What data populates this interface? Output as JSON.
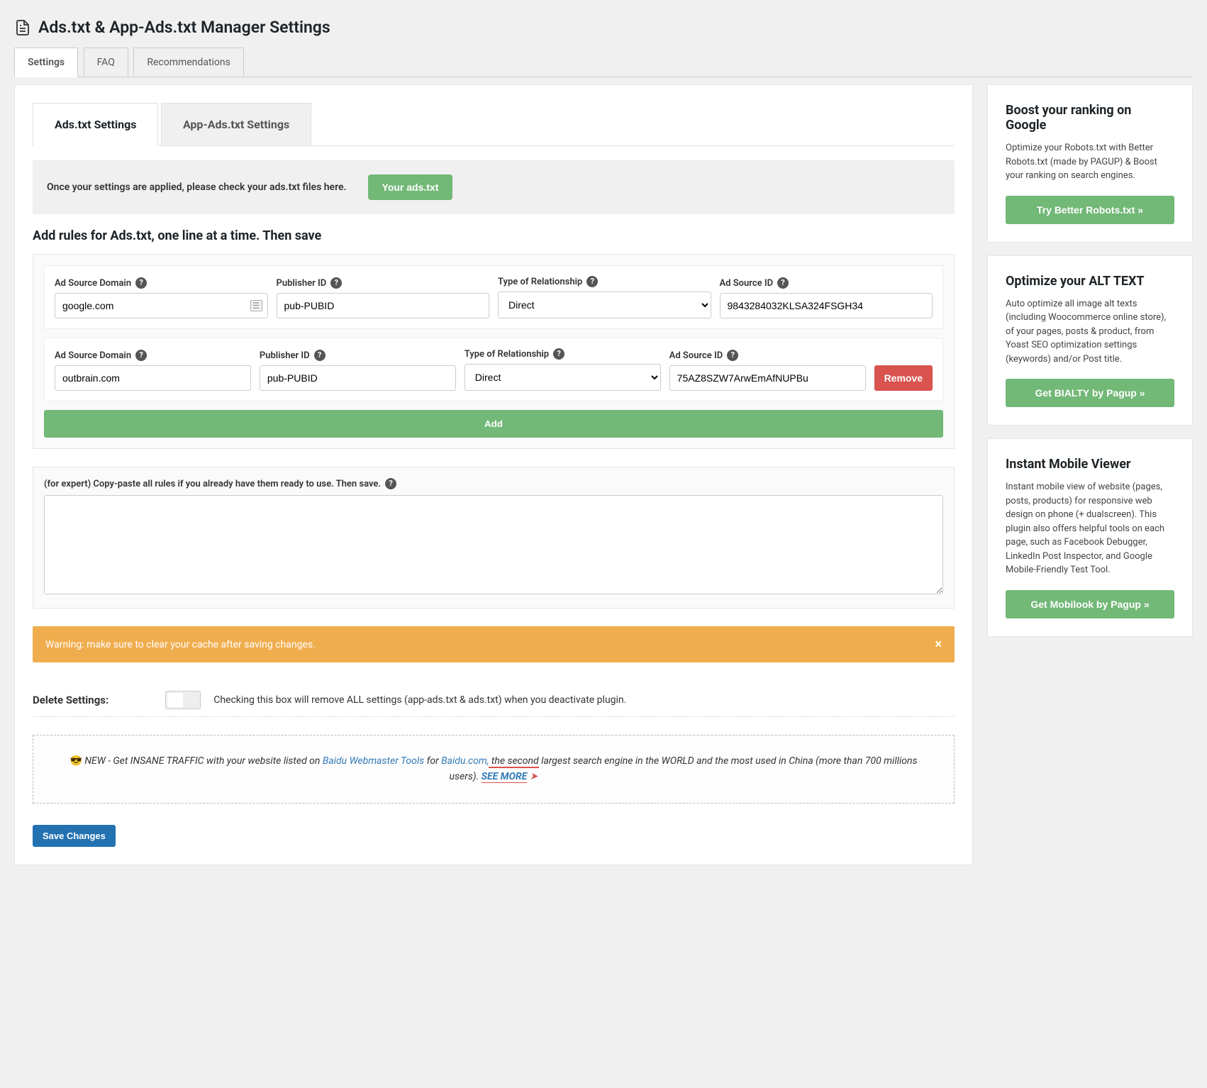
{
  "pageTitle": "Ads.txt & App-Ads.txt Manager Settings",
  "topTabs": [
    "Settings",
    "FAQ",
    "Recommendations"
  ],
  "innerTabs": [
    "Ads.txt Settings",
    "App-Ads.txt Settings"
  ],
  "notice": {
    "text": "Once your settings are applied, please check your ads.txt files here.",
    "button": "Your ads.txt"
  },
  "sectionHeading": "Add rules for Ads.txt, one line at a time. Then save",
  "fieldLabels": {
    "domain": "Ad Source Domain",
    "publisherId": "Publisher ID",
    "relationship": "Type of Relationship",
    "sourceId": "Ad Source ID"
  },
  "relationshipOptions": [
    "Direct"
  ],
  "rows": [
    {
      "domain": "google.com",
      "publisherId": "pub-PUBID",
      "relationship": "Direct",
      "sourceId": "9843284032KLSA324FSGH34",
      "hasRemove": false,
      "hasIcon": true
    },
    {
      "domain": "outbrain.com",
      "publisherId": "pub-PUBID",
      "relationship": "Direct",
      "sourceId": "75AZ8SZW7ArwEmAfNUPBu",
      "hasRemove": true,
      "hasIcon": false
    }
  ],
  "addButton": "Add",
  "removeButton": "Remove",
  "expert": {
    "label": "(for expert) Copy-paste all rules if you already have them ready to use. Then save.",
    "value": ""
  },
  "warning": "Warning: make sure to clear your cache after saving changes.",
  "deleteSection": {
    "label": "Delete Settings:",
    "desc": "Checking this box will remove ALL settings (app-ads.txt & ads.txt) when you deactivate plugin."
  },
  "promo": {
    "prefix": " NEW - Get INSANE TRAFFIC with your website listed on ",
    "link1": "Baidu Webmaster Tools",
    "mid1": " for ",
    "link2": "Baidu.com,",
    "mid2": " the second",
    "rest1": " largest search engine in the WORLD and the most used in China (more than 700 millions users). ",
    "seeMore": "SEE MORE",
    "arrow": " ➤"
  },
  "saveButton": "Save Changes",
  "sidebar": [
    {
      "title": "Boost your ranking on Google",
      "body": "Optimize your Robots.txt with Better Robots.txt (made by PAGUP) & Boost your ranking on search engines.",
      "button": "Try Better Robots.txt »"
    },
    {
      "title": "Optimize your ALT TEXT",
      "body": "Auto optimize all image alt texts (including Woocommerce online store), of your pages, posts & product, from Yoast SEO optimization settings (keywords) and/or Post title.",
      "button": "Get BIALTY by Pagup »"
    },
    {
      "title": "Instant Mobile Viewer",
      "body": "Instant mobile view of website (pages, posts, products) for responsive web design on phone (+ dualscreen). This plugin also offers helpful tools on each page, such as Facebook Debugger, LinkedIn Post Inspector, and Google Mobile-Friendly Test Tool.",
      "button": "Get Mobilook by Pagup »"
    }
  ]
}
